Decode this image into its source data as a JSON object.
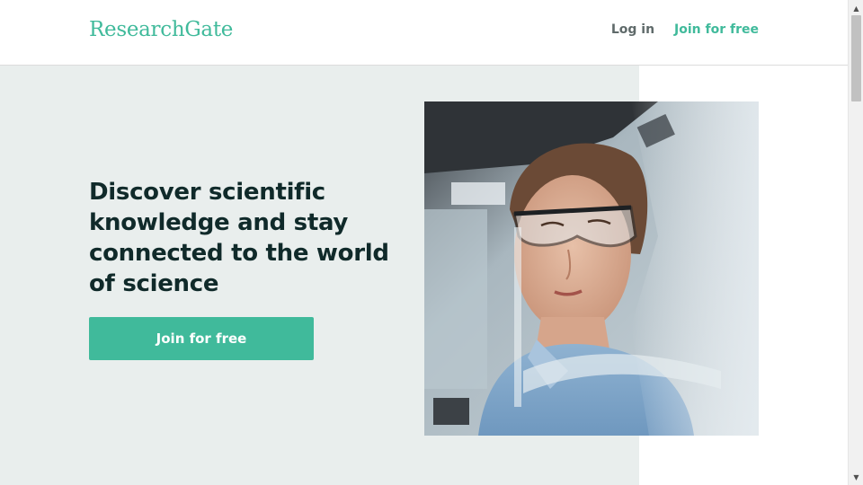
{
  "header": {
    "logo": "ResearchGate",
    "login_label": "Log in",
    "join_label": "Join for free"
  },
  "hero": {
    "headline": "Discover scientific knowledge and stay connected to the world of science",
    "cta_label": "Join for free",
    "image_description": "lab-researcher-with-safety-glasses"
  },
  "scrollbar": {
    "up_icon": "▲",
    "down_icon": "▼"
  },
  "colors": {
    "brand": "#40ba9b",
    "hero_bg": "#e9eeed",
    "headline": "#102a2a",
    "nav_text": "#5f6a6a"
  }
}
